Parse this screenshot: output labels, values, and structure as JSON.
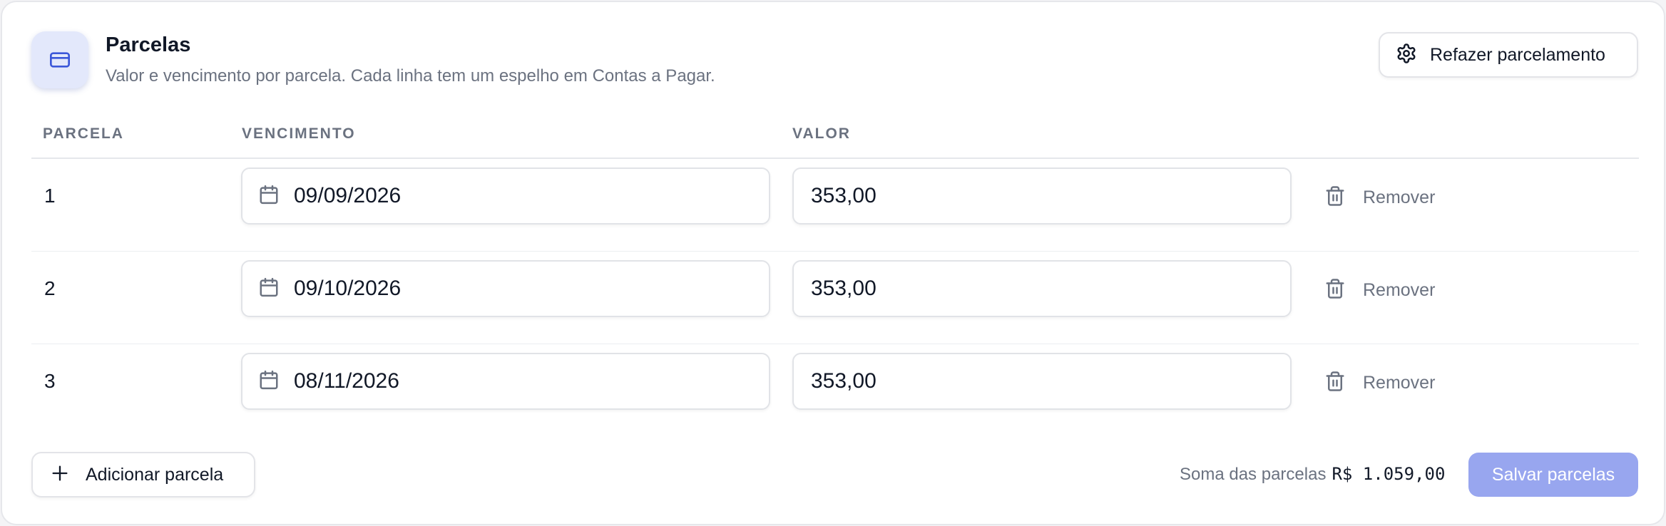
{
  "header": {
    "icon": "credit-card-icon",
    "title": "Parcelas",
    "subtitle": "Valor e vencimento por parcela. Cada linha tem um espelho em Contas a Pagar.",
    "redo_button": {
      "icon": "gear-icon",
      "label": "Refazer parcelamento"
    }
  },
  "table": {
    "columns": [
      "PARCELA",
      "VENCIMENTO",
      "VALOR"
    ],
    "rows": [
      {
        "number": "1",
        "due_date": "09/09/2026",
        "value": "353,00",
        "remove_label": "Remover"
      },
      {
        "number": "2",
        "due_date": "09/10/2026",
        "value": "353,00",
        "remove_label": "Remover"
      },
      {
        "number": "3",
        "due_date": "08/11/2026",
        "value": "353,00",
        "remove_label": "Remover"
      }
    ]
  },
  "footer": {
    "add_button": {
      "icon": "plus-icon",
      "label": "Adicionar parcela"
    },
    "sum_label": "Soma das parcelas",
    "sum_value": "R$ 1.059,00",
    "save_button": {
      "label": "Salvar parcelas"
    }
  },
  "colors": {
    "accent": "#3b57d9",
    "accent_soft": "#e3e8fb",
    "save_button_disabled": "#98a6ef",
    "muted_text": "#6b7280"
  }
}
